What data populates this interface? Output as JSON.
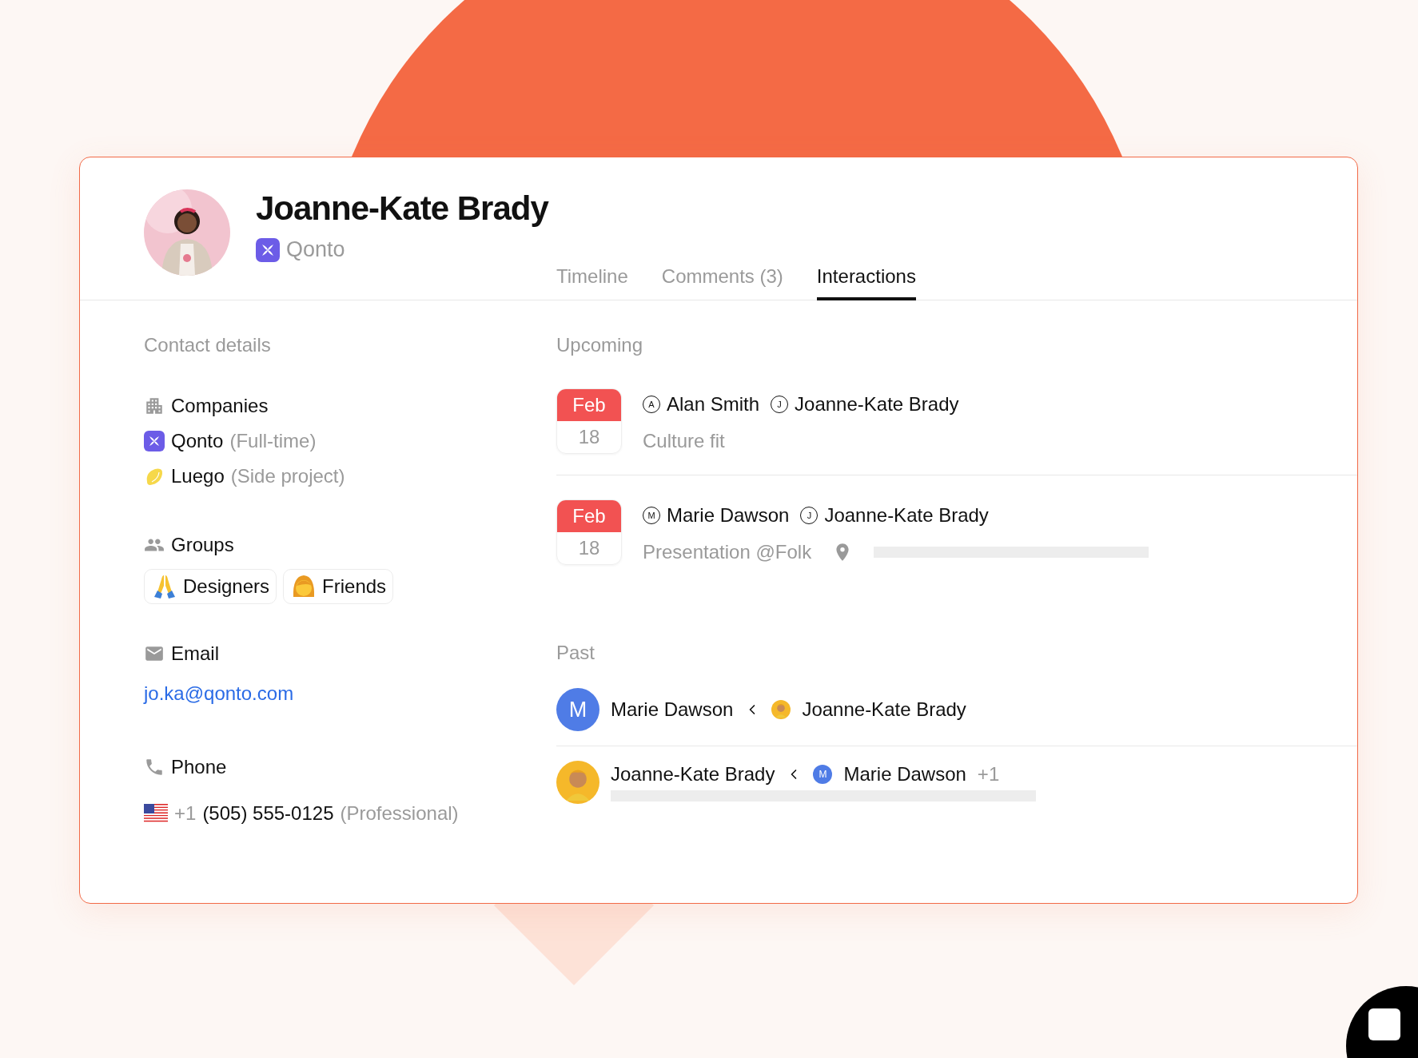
{
  "profile": {
    "name": "Joanne-Kate Brady",
    "company": "Qonto"
  },
  "tabs": [
    {
      "label": "Timeline",
      "selected": false
    },
    {
      "label": "Comments (3)",
      "selected": false
    },
    {
      "label": "Interactions",
      "selected": true
    }
  ],
  "contact": {
    "heading": "Contact details",
    "companies": {
      "label": "Companies",
      "items": [
        {
          "name": "Qonto",
          "note": "(Full-time)",
          "kind": "qonto"
        },
        {
          "name": "Luego",
          "note": "(Side project)",
          "kind": "luego"
        }
      ]
    },
    "groups": {
      "label": "Groups",
      "items": [
        {
          "name": "Designers",
          "kind": "hands"
        },
        {
          "name": "Friends",
          "kind": "woman"
        }
      ]
    },
    "email": {
      "label": "Email",
      "value": "jo.ka@qonto.com"
    },
    "phone": {
      "label": "Phone",
      "prefix": "+1",
      "number": "(505) 555-0125",
      "note": "(Professional)"
    }
  },
  "upcoming": {
    "heading": "Upcoming",
    "events": [
      {
        "month": "Feb",
        "day": "18",
        "attendees": [
          {
            "initial": "A",
            "name": "Alan Smith"
          },
          {
            "initial": "J",
            "name": "Joanne-Kate Brady"
          }
        ],
        "title": "Culture fit",
        "location": false
      },
      {
        "month": "Feb",
        "day": "18",
        "attendees": [
          {
            "initial": "M",
            "name": "Marie Dawson"
          },
          {
            "initial": "J",
            "name": "Joanne-Kate Brady"
          }
        ],
        "title": "Presentation @Folk",
        "location": true
      }
    ]
  },
  "past": {
    "heading": "Past",
    "items": [
      {
        "from": {
          "name": "Marie Dawson",
          "avatar": {
            "kind": "letter",
            "initial": "M"
          }
        },
        "to": {
          "name": "Joanne-Kate Brady",
          "avatar": {
            "kind": "figure"
          }
        },
        "preview": false
      },
      {
        "from": {
          "name": "Joanne-Kate Brady",
          "avatar": {
            "kind": "figure"
          }
        },
        "to": {
          "name": "Marie Dawson",
          "avatar": {
            "kind": "letter",
            "initial": "M"
          }
        },
        "extra": "+1",
        "preview": true
      }
    ]
  }
}
